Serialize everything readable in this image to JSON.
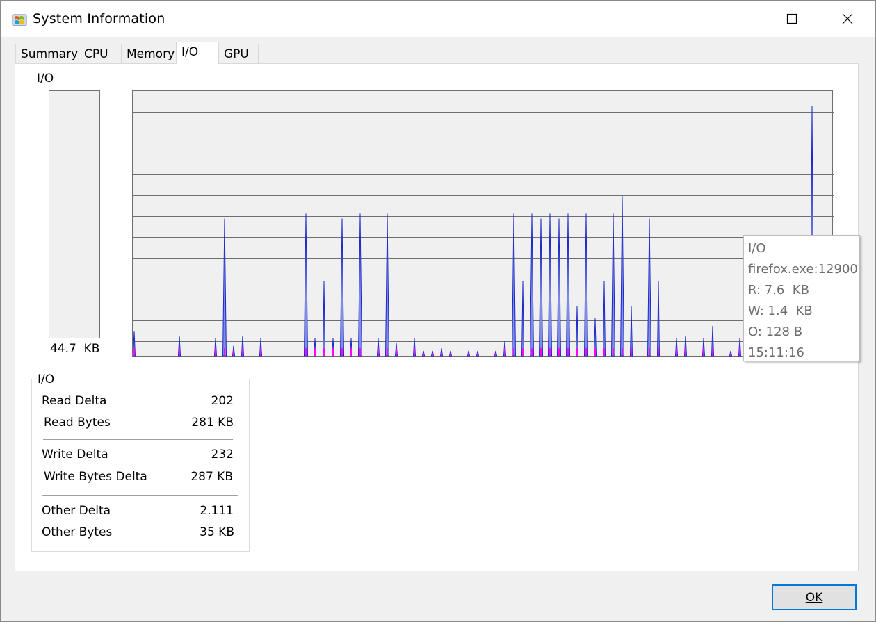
{
  "window": {
    "title": "System Information",
    "icon": "windows-flag-icon"
  },
  "tabs": [
    {
      "label": "Summary",
      "active": false
    },
    {
      "label": "CPU",
      "active": false
    },
    {
      "label": "Memory",
      "active": false
    },
    {
      "label": "I/O",
      "active": true
    },
    {
      "label": "GPU",
      "active": false
    }
  ],
  "io_panel": {
    "heading": "I/O",
    "meter_value": "44.7  KB",
    "meter_fill": 0
  },
  "tooltip": {
    "lines": [
      "I/O",
      "firefox.exe:12900",
      "R: 7.6  KB",
      "W: 1.4  KB",
      "O: 128 B",
      "15:11:16"
    ]
  },
  "stats": {
    "title": "I/O",
    "read_delta_label": "Read Delta",
    "read_delta_value": "202",
    "read_bytes_label": "Read Bytes",
    "read_bytes_value": "281 KB",
    "write_delta_label": "Write Delta",
    "write_delta_value": "232",
    "write_bytes_delta_label": "Write Bytes Delta",
    "write_bytes_delta_value": "287 KB",
    "other_delta_label": "Other Delta",
    "other_delta_value": "2.111",
    "other_bytes_label": "Other Bytes",
    "other_bytes_value": "35 KB"
  },
  "buttons": {
    "ok_label": "OK"
  },
  "colors": {
    "graph_background": "#f0f0f0",
    "grid": "#6e6e6e",
    "read_series": "#1c28c8",
    "read_fill": "#7f8ce6",
    "write_series": "#ff00ff",
    "accent": "#0078d7"
  },
  "chart_data": {
    "type": "area",
    "title": "",
    "xlabel": "",
    "ylabel": "",
    "grid": true,
    "ylim": [
      0,
      1
    ],
    "series": [
      {
        "values": [
          0.1,
          0,
          0,
          0,
          0,
          0.08,
          0,
          0,
          0,
          0.07,
          0.55,
          0.04,
          0.08,
          0,
          0.07,
          0,
          0,
          0,
          0,
          0.57,
          0.07,
          0.3,
          0.07,
          0.55,
          0.07,
          0.57,
          0,
          0.07,
          0.57,
          0.05,
          0,
          0.07,
          0.02,
          0.02,
          0.03,
          0.02,
          0,
          0.02,
          0.02,
          0,
          0.02,
          0.06,
          0.57,
          0.3,
          0.57,
          0.55,
          0.57,
          0.55,
          0.57,
          0.2,
          0.57,
          0.15,
          0.3,
          0.57,
          0.64,
          0.2,
          0,
          0.55,
          0.3,
          0,
          0.07,
          0.08,
          0,
          0.07,
          0.12,
          0,
          0.02,
          0.07,
          0,
          0.07,
          0,
          0.07,
          0.12,
          0,
          0.07,
          1.0,
          0.07
        ]
      },
      {
        "values": [
          0.03,
          0,
          0,
          0,
          0,
          0.03,
          0,
          0,
          0,
          0.03,
          0.03,
          0.02,
          0.03,
          0,
          0.03,
          0,
          0,
          0,
          0,
          0.03,
          0.03,
          0.03,
          0.03,
          0.03,
          0.03,
          0.03,
          0,
          0.03,
          0.03,
          0.03,
          0,
          0.03,
          0.01,
          0.01,
          0.01,
          0.01,
          0,
          0.01,
          0.01,
          0,
          0.01,
          0.03,
          0.03,
          0.03,
          0.03,
          0.03,
          0.03,
          0.03,
          0.03,
          0.03,
          0.03,
          0.03,
          0.03,
          0.03,
          0.03,
          0.03,
          0,
          0.03,
          0.03,
          0,
          0.03,
          0.03,
          0,
          0.03,
          0.03,
          0,
          0.01,
          0.03,
          0,
          0.03,
          0,
          0.03,
          0.03,
          0,
          0.03,
          0.03,
          0.03
        ]
      }
    ]
  }
}
